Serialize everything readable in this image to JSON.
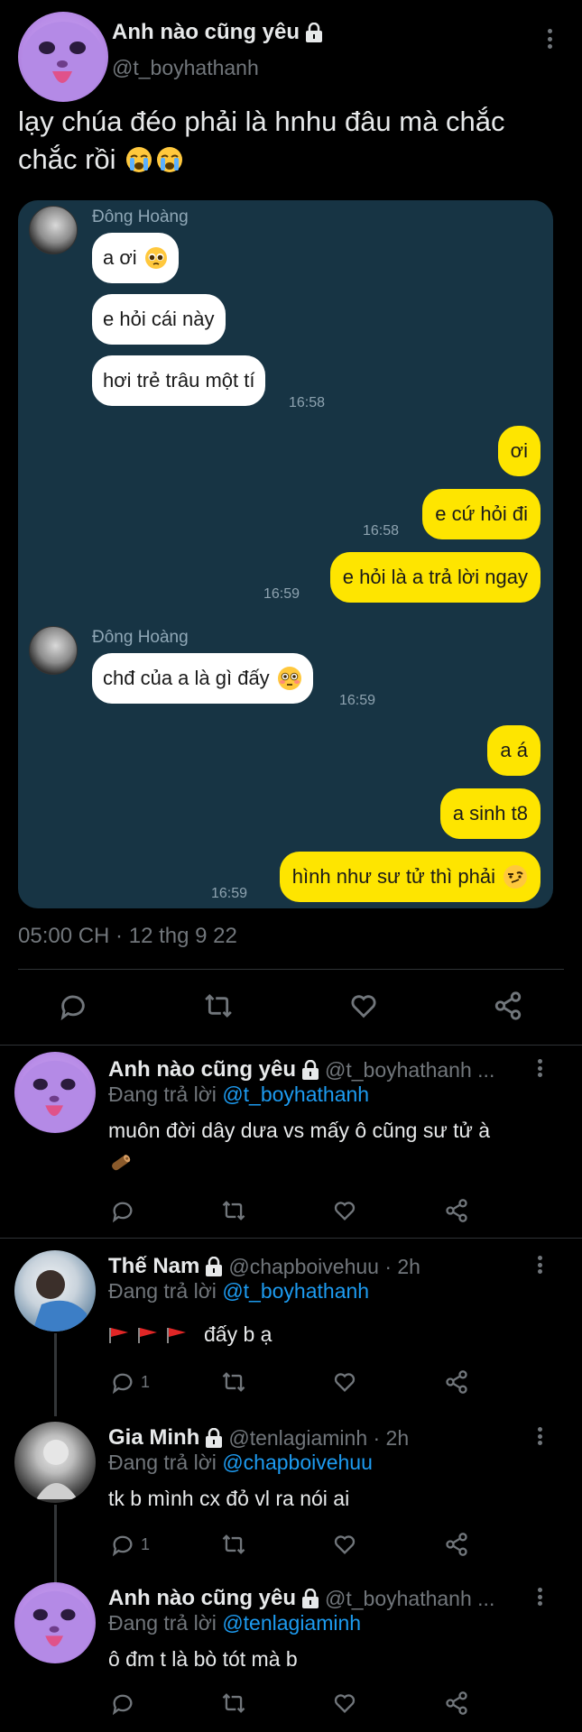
{
  "tweet": {
    "name": "Anh nào cũng yêu",
    "handle": "@t_boyhathanh",
    "text_line1": "lạy chúa đéo phải là hnhu đâu mà chắc",
    "text_line2": "chắc rồi",
    "timestamp": "05:00 CH · 12 thg 9 22"
  },
  "chat": {
    "sender": "Đông Hoàng",
    "messages": [
      {
        "dir": "in",
        "text": "a ơi"
      },
      {
        "dir": "in",
        "text": "e hỏi cái này"
      },
      {
        "dir": "in",
        "text": "hơi trẻ trâu một tí",
        "time": "16:58"
      },
      {
        "dir": "out",
        "text": "ơi"
      },
      {
        "dir": "out",
        "text": "e cứ hỏi đi",
        "time": "16:58"
      },
      {
        "dir": "out",
        "text": "e hỏi là a trả lời ngay",
        "time": "16:59"
      },
      {
        "dir": "in",
        "text": "chđ của a là gì đấy",
        "time": "16:59"
      },
      {
        "dir": "out",
        "text": "a á"
      },
      {
        "dir": "out",
        "text": "a sinh t8"
      },
      {
        "dir": "out",
        "text": "hình như sư tử thì phải",
        "time": "16:59"
      }
    ]
  },
  "replying_prefix": "Đang trả lời",
  "replies": [
    {
      "name": "Anh nào cũng yêu",
      "handle": "@t_boyhathanh ...",
      "replying_to": "@t_boyhathanh",
      "text": "muôn đời dây dưa vs mấy ô cũng sư tử à",
      "text_extra": "🪵",
      "reply_count": ""
    },
    {
      "name": "Thế Nam",
      "handle": "@chapboivehuu · 2h",
      "replying_to": "@t_boyhathanh",
      "text": "đấy b ạ",
      "reply_count": "1"
    },
    {
      "name": "Gia Minh",
      "handle": "@tenlagiaminh · 2h",
      "replying_to": "@chapboivehuu",
      "text": "tk b mình cx đỏ vl ra nói ai",
      "reply_count": "1"
    },
    {
      "name": "Anh nào cũng yêu",
      "handle": "@t_boyhathanh ...",
      "replying_to": "@tenlagiaminh",
      "text": "ô đm t là bò tót mà b",
      "reply_count": ""
    }
  ],
  "icons": [
    "lock-icon",
    "more-icon",
    "reply-icon",
    "retweet-icon",
    "like-icon",
    "share-icon",
    "red-flag-icon",
    "crying-emoji",
    "pleading-emoji",
    "flushed-emoji",
    "smirk-emoji"
  ],
  "colors": {
    "background": "#000000",
    "chat_bg": "#173444",
    "outgoing_bubble": "#fee500",
    "mention": "#1d9bf0",
    "muted": "#71767b"
  }
}
